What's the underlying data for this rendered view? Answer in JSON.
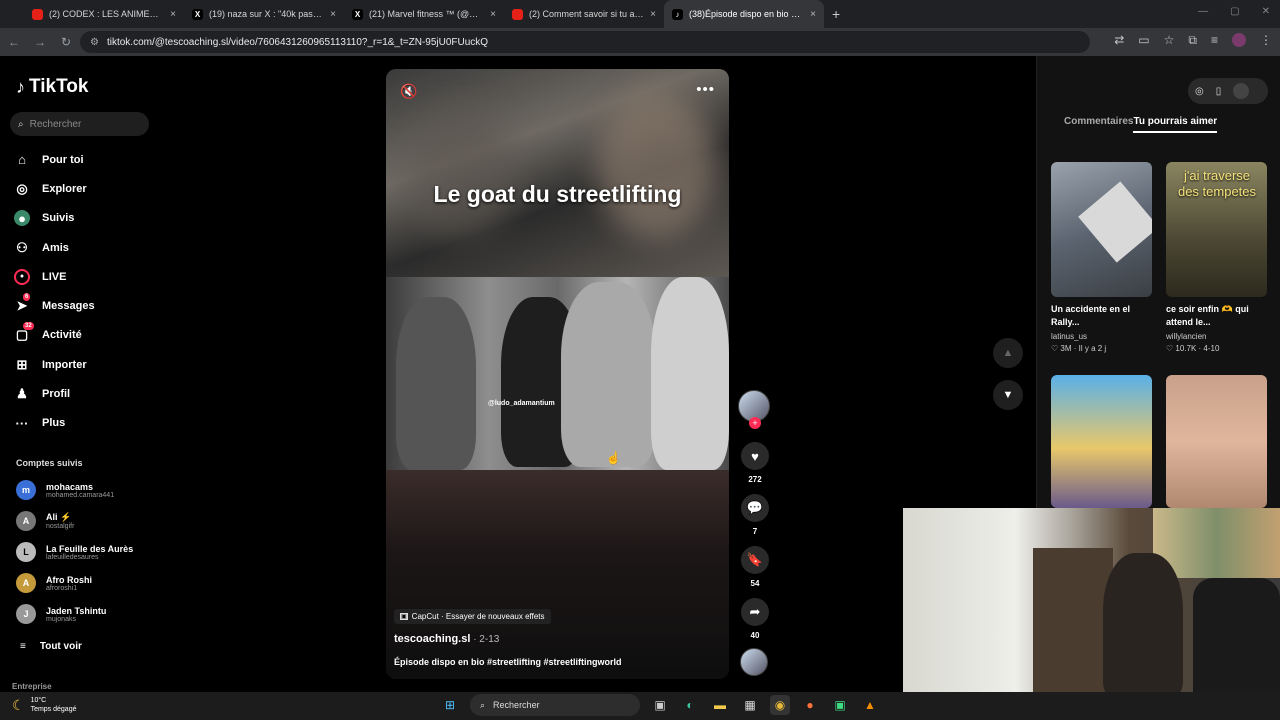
{
  "tabs": [
    {
      "icon": "youtube-icon",
      "title": "(2) CODEX : LES ANIMES SONT",
      "close": "×"
    },
    {
      "icon": "x-icon",
      "title": "(19) naza sur X : \"40k pas par jo",
      "close": "×"
    },
    {
      "icon": "x-icon",
      "title": "(21) Marvel fitness ™ (@Marve",
      "close": "×"
    },
    {
      "icon": "youtube-icon",
      "title": "(2) Comment savoir si tu as un",
      "close": "×"
    },
    {
      "icon": "tiktok-icon",
      "title": "(38)Épisode dispo en bio #stree",
      "close": "×"
    }
  ],
  "newtab": "+",
  "url": "tiktok.com/@tescoaching.sl/video/7606431260965113110?_r=1&_t=ZN-95jU0FUuckQ",
  "brand": {
    "name": "TikTok"
  },
  "search_placeholder": "Rechercher",
  "nav": [
    {
      "label": "Pour toi",
      "icon": "home-icon"
    },
    {
      "label": "Explorer",
      "icon": "compass-icon"
    },
    {
      "label": "Suivis",
      "icon": "following-icon"
    },
    {
      "label": "Amis",
      "icon": "friends-icon"
    },
    {
      "label": "LIVE",
      "icon": "live-icon"
    },
    {
      "label": "Messages",
      "icon": "messages-icon",
      "badge": "6"
    },
    {
      "label": "Activité",
      "icon": "activity-icon",
      "badge": "32"
    },
    {
      "label": "Importer",
      "icon": "upload-icon"
    },
    {
      "label": "Profil",
      "icon": "profile-icon"
    },
    {
      "label": "Plus",
      "icon": "more-icon"
    }
  ],
  "followed_header": "Comptes suivis",
  "followed": [
    {
      "name": "mohacams",
      "user": "mohamed.camara441",
      "initial": "m",
      "color": "#3a6fd8"
    },
    {
      "name": "Ali ⚡",
      "user": "nostalgifr",
      "initial": "A",
      "color": "#777"
    },
    {
      "name": "La Feuille des Aurès",
      "user": "lafeuilledesaures",
      "initial": "L",
      "color": "#bbb"
    },
    {
      "name": "Afro Roshi",
      "user": "afroroshi1",
      "initial": "A",
      "color": "#c49a3a"
    },
    {
      "name": "Jaden Tshintu",
      "user": "mujonaks",
      "initial": "J",
      "color": "#999"
    }
  ],
  "see_all": "Tout voir",
  "entreprise": "Entreprise",
  "video": {
    "title_overlay": "Le goat du streetlifting",
    "watermark": "@ludo_adamantium",
    "capcut": "CapCut · Essayer de nouveaux effets",
    "author": "tescoaching.sl",
    "date": " · 2-13",
    "description": "Épisode dispo en bio #streetlifting #streetliftingworld"
  },
  "actions": [
    {
      "icon": "heart-icon",
      "count": "272"
    },
    {
      "icon": "comment-icon",
      "count": "7"
    },
    {
      "icon": "bookmark-icon",
      "count": "54"
    },
    {
      "icon": "share-icon",
      "count": "40"
    }
  ],
  "right_tabs": {
    "comments": "Commentaires",
    "suggested": "Tu pourrais aimer"
  },
  "cards": [
    {
      "title": "Un accidente en el Rally...",
      "user": "latinus_us",
      "stat": "♡ 3M · Il y a 2 j",
      "thumb_text": ""
    },
    {
      "title": "ce soir enfin 🫶 qui attend le...",
      "user": "willylancien",
      "stat": "♡ 10.7K · 4-10",
      "thumb_text": "j'ai traverse des tempetes"
    },
    {
      "title": "",
      "user": "",
      "stat": "",
      "thumb_text": ""
    },
    {
      "title": "",
      "user": "",
      "stat": "",
      "thumb_text": ""
    }
  ],
  "taskbar": {
    "temp": "10°C",
    "weather": "Temps dégagé",
    "search": "Rechercher"
  }
}
